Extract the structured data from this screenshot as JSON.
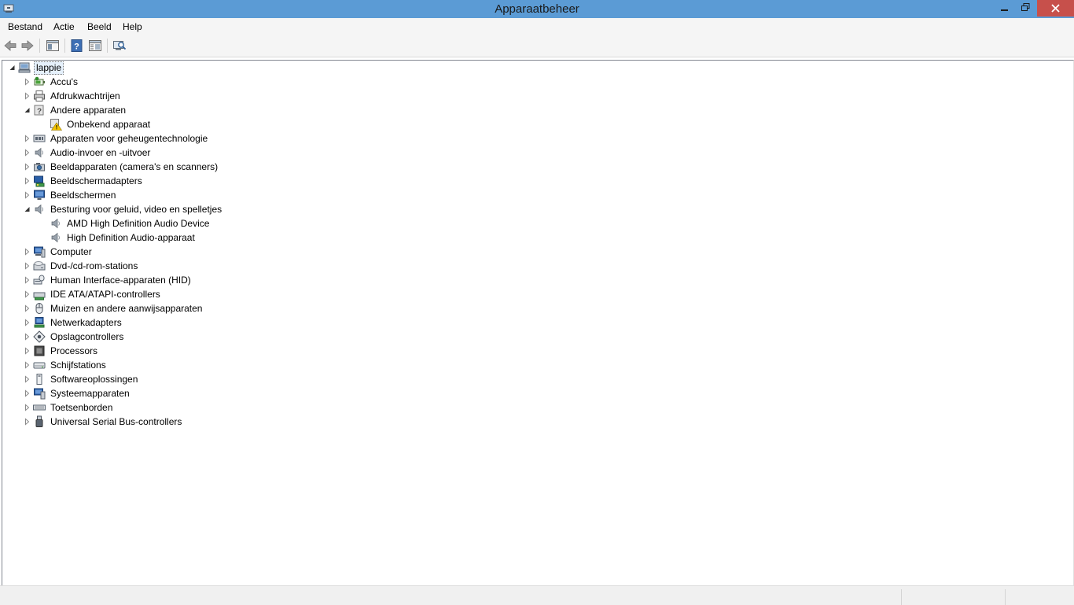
{
  "window": {
    "title": "Apparaatbeheer",
    "icons": [
      "device-manager-icon",
      "minimize-icon",
      "restore-icon",
      "close-icon"
    ]
  },
  "menu": [
    "Bestand",
    "Actie",
    "Beeld",
    "Help"
  ],
  "toolbar": {
    "icons": [
      "back-arrow-icon",
      "forward-arrow-icon",
      "show-hide-console-tree-icon",
      "help-icon",
      "properties-icon",
      "scan-hardware-icon"
    ]
  },
  "tree": {
    "root": "lappie",
    "items": [
      {
        "label": "Accu's",
        "icon": "battery-icon",
        "expanded": false
      },
      {
        "label": "Afdrukwachtrijen",
        "icon": "printer-icon",
        "expanded": false
      },
      {
        "label": "Andere apparaten",
        "icon": "unknown-device-icon",
        "expanded": true
      },
      {
        "label": "Onbekend apparaat",
        "icon": "warning-device-icon",
        "child": true
      },
      {
        "label": "Apparaten voor geheugentechnologie",
        "icon": "memory-device-icon",
        "expanded": false
      },
      {
        "label": "Audio-invoer en -uitvoer",
        "icon": "speaker-icon",
        "expanded": false
      },
      {
        "label": "Beeldapparaten (camera's en scanners)",
        "icon": "camera-icon",
        "expanded": false
      },
      {
        "label": "Beeldschermadapters",
        "icon": "display-adapter-icon",
        "expanded": false
      },
      {
        "label": "Beeldschermen",
        "icon": "monitor-icon",
        "expanded": false
      },
      {
        "label": "Besturing voor geluid, video en spelletjes",
        "icon": "speaker-icon",
        "expanded": true
      },
      {
        "label": "AMD High Definition Audio Device",
        "icon": "speaker-icon",
        "child": true
      },
      {
        "label": "High Definition Audio-apparaat",
        "icon": "speaker-icon",
        "child": true
      },
      {
        "label": "Computer",
        "icon": "computer-icon",
        "expanded": false
      },
      {
        "label": "Dvd-/cd-rom-stations",
        "icon": "optical-drive-icon",
        "expanded": false
      },
      {
        "label": "Human Interface-apparaten (HID)",
        "icon": "hid-icon",
        "expanded": false
      },
      {
        "label": "IDE ATA/ATAPI-controllers",
        "icon": "ide-controller-icon",
        "expanded": false
      },
      {
        "label": "Muizen en andere aanwijsapparaten",
        "icon": "mouse-icon",
        "expanded": false
      },
      {
        "label": "Netwerkadapters",
        "icon": "network-adapter-icon",
        "expanded": false
      },
      {
        "label": "Opslagcontrollers",
        "icon": "storage-controller-icon",
        "expanded": false
      },
      {
        "label": "Processors",
        "icon": "processor-icon",
        "expanded": false
      },
      {
        "label": "Schijfstations",
        "icon": "disk-drive-icon",
        "expanded": false
      },
      {
        "label": "Softwareoplossingen",
        "icon": "software-component-icon",
        "expanded": false
      },
      {
        "label": "Systeemapparaten",
        "icon": "system-device-icon",
        "expanded": false
      },
      {
        "label": "Toetsenborden",
        "icon": "keyboard-icon",
        "expanded": false
      },
      {
        "label": "Universal Serial Bus-controllers",
        "icon": "usb-icon",
        "expanded": false
      }
    ]
  },
  "colors": {
    "titlebar": "#5b9bd5",
    "close_button": "#c7504b",
    "selection": "#e5f0fb"
  }
}
